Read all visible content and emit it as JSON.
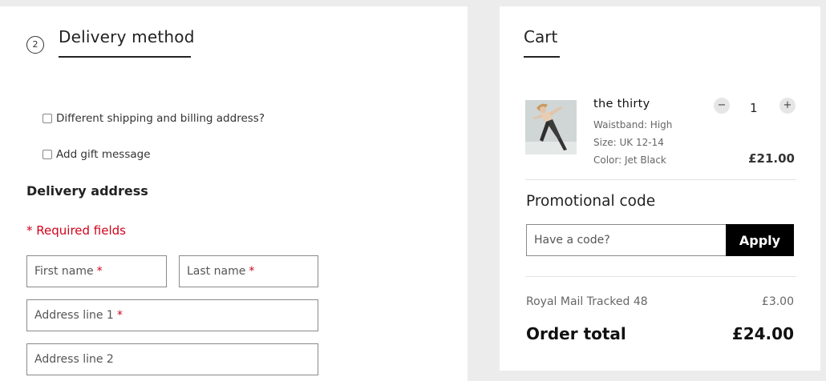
{
  "delivery": {
    "step_number": "2",
    "title": "Delivery method",
    "different_address_label": "Different shipping and billing address?",
    "gift_message_label": "Add gift message",
    "address_heading": "Delivery address",
    "required_note": "* Required fields",
    "required_star": "*",
    "fields": {
      "first_name": "First name",
      "last_name": "Last name",
      "address_line_1": "Address line 1",
      "address_line_2": "Address line 2"
    }
  },
  "cart": {
    "title": "Cart",
    "item": {
      "name": "the thirty",
      "waistband": "Waistband: High",
      "size": "Size: UK 12-14",
      "color": "Color: Jet Black",
      "quantity": "1",
      "minus_symbol": "−",
      "plus_symbol": "+",
      "price": "£21.00"
    },
    "promo": {
      "title": "Promotional code",
      "placeholder": "Have a code?",
      "apply_label": "Apply"
    },
    "shipping": {
      "label": "Royal Mail Tracked 48",
      "price": "£3.00"
    },
    "total": {
      "label": "Order total",
      "price": "£24.00"
    }
  },
  "colors": {
    "background": "#ececec",
    "panel": "#ffffff",
    "required_red": "#d0021b",
    "button_black": "#000000"
  },
  "icons": {
    "minus": "minus-icon",
    "plus": "plus-icon",
    "checkbox": "checkbox-icon"
  }
}
